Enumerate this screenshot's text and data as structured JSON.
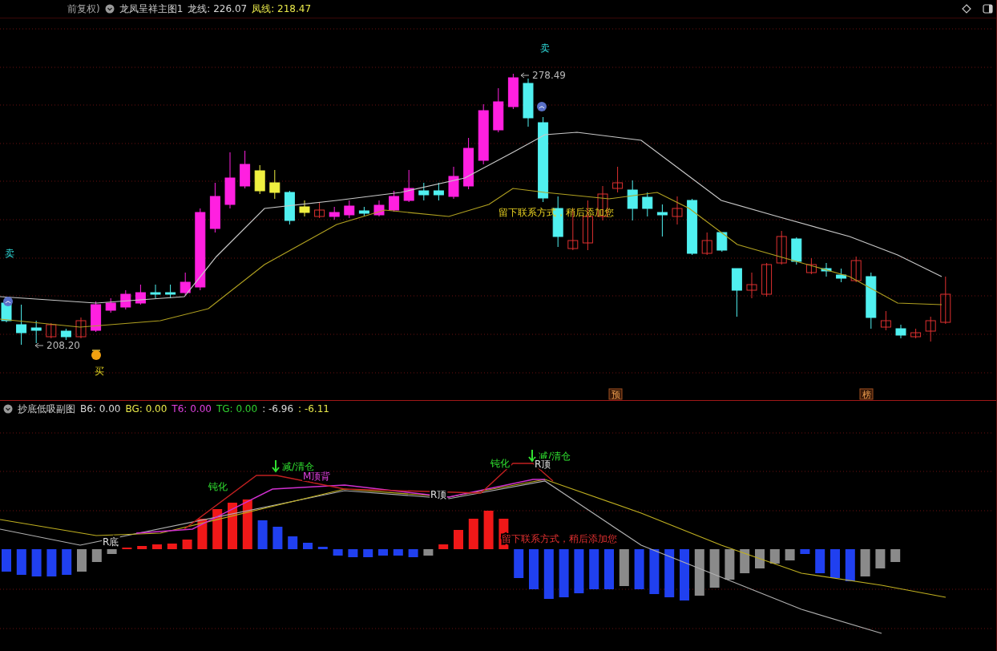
{
  "main_header": {
    "adjust": "前复权)",
    "title": "龙凤呈祥主图1",
    "values": [
      {
        "label": "龙线: 226.07",
        "color": "#d8d8d8"
      },
      {
        "label": "凤线: 218.47",
        "color": "#e8e84a"
      }
    ]
  },
  "main_chart": {
    "annotations": [
      {
        "kind": "sell",
        "text": "卖"
      },
      {
        "kind": "sell",
        "text": "卖"
      },
      {
        "kind": "price",
        "text": "278.49"
      },
      {
        "kind": "price",
        "text": "208.20"
      },
      {
        "kind": "buy",
        "text": "买"
      },
      {
        "kind": "note",
        "text": "留下联系方式，稍后添加您"
      }
    ],
    "markers": [
      "预",
      "榜"
    ]
  },
  "sub_header": {
    "title": "抄底低吸副图",
    "values": [
      {
        "label": "B6: 0.00",
        "color": "#d8d8d8"
      },
      {
        "label": "BG: 0.00",
        "color": "#e8e84a"
      },
      {
        "label": "T6: 0.00",
        "color": "#e040e0"
      },
      {
        "label": "TG: 0.00",
        "color": "#30d030"
      },
      {
        "label": ": -6.96",
        "color": "#d8d8d8"
      },
      {
        "label": ": -6.11",
        "color": "#e8e84a"
      }
    ]
  },
  "sub_chart": {
    "annotations": [
      {
        "kind": "bottom",
        "text": "R底"
      },
      {
        "kind": "blunt",
        "text": "钝化"
      },
      {
        "kind": "reduce",
        "text": "减/清仓"
      },
      {
        "kind": "divergence",
        "text": "M顶背"
      },
      {
        "kind": "top",
        "text": "R顶"
      },
      {
        "kind": "blunt",
        "text": "钝化"
      },
      {
        "kind": "reduce",
        "text": "减/清仓"
      },
      {
        "kind": "top",
        "text": "R顶"
      },
      {
        "kind": "note",
        "text": "留下联系方式，稍后添加您"
      }
    ]
  }
}
